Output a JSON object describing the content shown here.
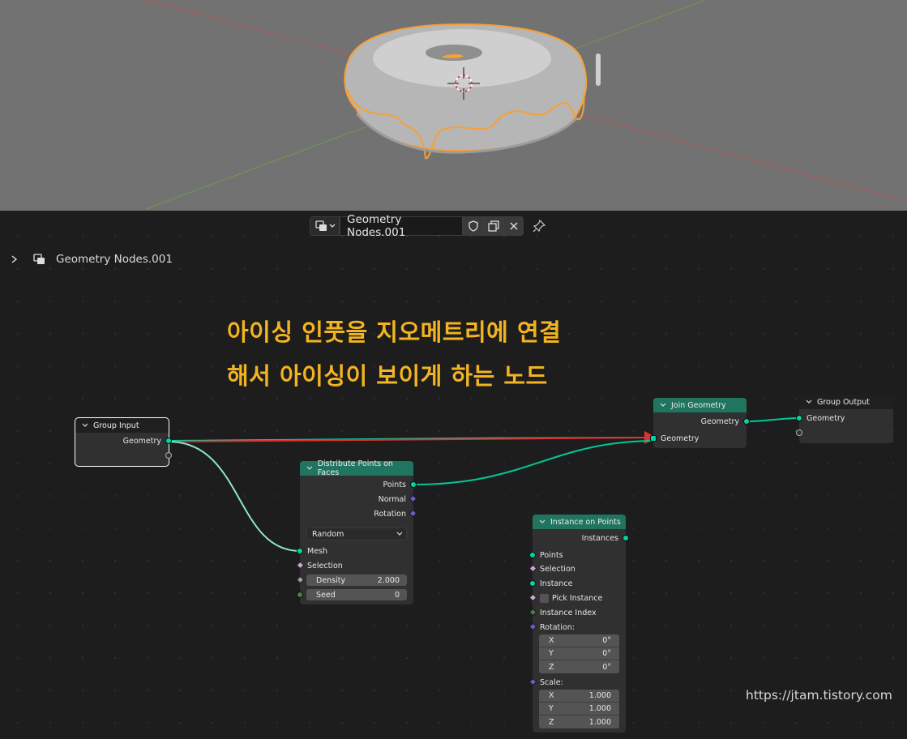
{
  "header": {
    "node_group_name": "Geometry Nodes.001"
  },
  "breadcrumb": {
    "label": "Geometry Nodes.001"
  },
  "annotation": {
    "line1": "아이싱 인풋을 지오메트리에 연결",
    "line2": "해서 아이싱이 보이게 하는 노드"
  },
  "watermark": "https://jtam.tistory.com",
  "nodes": {
    "group_input": {
      "title": "Group Input",
      "outputs": [
        "Geometry"
      ]
    },
    "distribute": {
      "title": "Distribute Points on Faces",
      "outputs": [
        "Points",
        "Normal",
        "Rotation"
      ],
      "mode": "Random",
      "inputs": {
        "mesh": "Mesh",
        "selection": "Selection",
        "density_label": "Density",
        "density_value": "2.000",
        "seed_label": "Seed",
        "seed_value": "0"
      }
    },
    "join": {
      "title": "Join Geometry",
      "output": "Geometry",
      "input": "Geometry"
    },
    "group_output": {
      "title": "Group Output",
      "input": "Geometry"
    },
    "instance_on_points": {
      "title": "Instance on Points",
      "output": "Instances",
      "inputs": {
        "points": "Points",
        "selection": "Selection",
        "instance": "Instance",
        "pick_instance": "Pick Instance",
        "instance_index": "Instance Index",
        "rotation": "Rotation:",
        "scale": "Scale:"
      },
      "rotation": [
        {
          "axis": "X",
          "value": "0°"
        },
        {
          "axis": "Y",
          "value": "0°"
        },
        {
          "axis": "Z",
          "value": "0°"
        }
      ],
      "scale": [
        {
          "axis": "X",
          "value": "1.000"
        },
        {
          "axis": "Y",
          "value": "1.000"
        },
        {
          "axis": "Z",
          "value": "1.000"
        }
      ]
    }
  },
  "colors": {
    "geometry_socket": "#00d6a3",
    "node_header_green": "#207560",
    "annotation": "#f2b420",
    "selection_outline": "#f7a035",
    "arrow": "#e03030"
  }
}
